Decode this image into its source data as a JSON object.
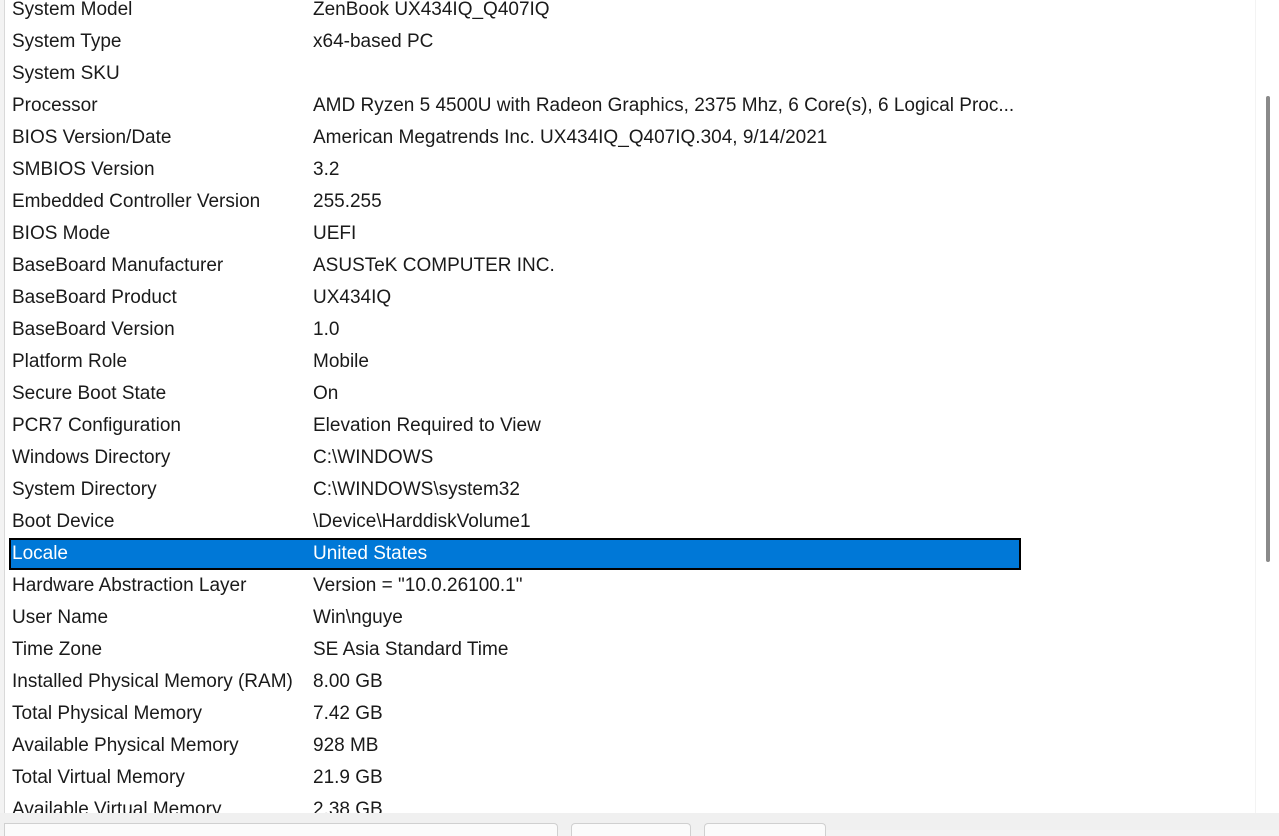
{
  "system_summary": {
    "rows": [
      {
        "item": "System Model",
        "value": "ZenBook UX434IQ_Q407IQ"
      },
      {
        "item": "System Type",
        "value": "x64-based PC"
      },
      {
        "item": "System SKU",
        "value": ""
      },
      {
        "item": "Processor",
        "value": "AMD Ryzen 5 4500U with Radeon Graphics, 2375 Mhz, 6 Core(s), 6 Logical Proc..."
      },
      {
        "item": "BIOS Version/Date",
        "value": "American Megatrends Inc. UX434IQ_Q407IQ.304, 9/14/2021"
      },
      {
        "item": "SMBIOS Version",
        "value": "3.2"
      },
      {
        "item": "Embedded Controller Version",
        "value": "255.255"
      },
      {
        "item": "BIOS Mode",
        "value": "UEFI"
      },
      {
        "item": "BaseBoard Manufacturer",
        "value": "ASUSTeK COMPUTER INC."
      },
      {
        "item": "BaseBoard Product",
        "value": "UX434IQ"
      },
      {
        "item": "BaseBoard Version",
        "value": "1.0"
      },
      {
        "item": "Platform Role",
        "value": "Mobile"
      },
      {
        "item": "Secure Boot State",
        "value": "On"
      },
      {
        "item": "PCR7 Configuration",
        "value": "Elevation Required to View"
      },
      {
        "item": "Windows Directory",
        "value": "C:\\WINDOWS"
      },
      {
        "item": "System Directory",
        "value": "C:\\WINDOWS\\system32"
      },
      {
        "item": "Boot Device",
        "value": "\\Device\\HarddiskVolume1"
      },
      {
        "item": "Locale",
        "value": "United States"
      },
      {
        "item": "Hardware Abstraction Layer",
        "value": "Version = \"10.0.26100.1\""
      },
      {
        "item": "User Name",
        "value": "Win\\nguye"
      },
      {
        "item": "Time Zone",
        "value": "SE Asia Standard Time"
      },
      {
        "item": "Installed Physical Memory (RAM)",
        "value": "8.00 GB"
      },
      {
        "item": "Total Physical Memory",
        "value": "7.42 GB"
      },
      {
        "item": "Available Physical Memory",
        "value": "928 MB"
      },
      {
        "item": "Total Virtual Memory",
        "value": "21.9 GB"
      },
      {
        "item": "Available Virtual Memory",
        "value": "2.38 GB"
      }
    ],
    "selected_item": "Locale"
  },
  "colors": {
    "selection_background": "#0078d7",
    "selection_text": "#ffffff"
  }
}
